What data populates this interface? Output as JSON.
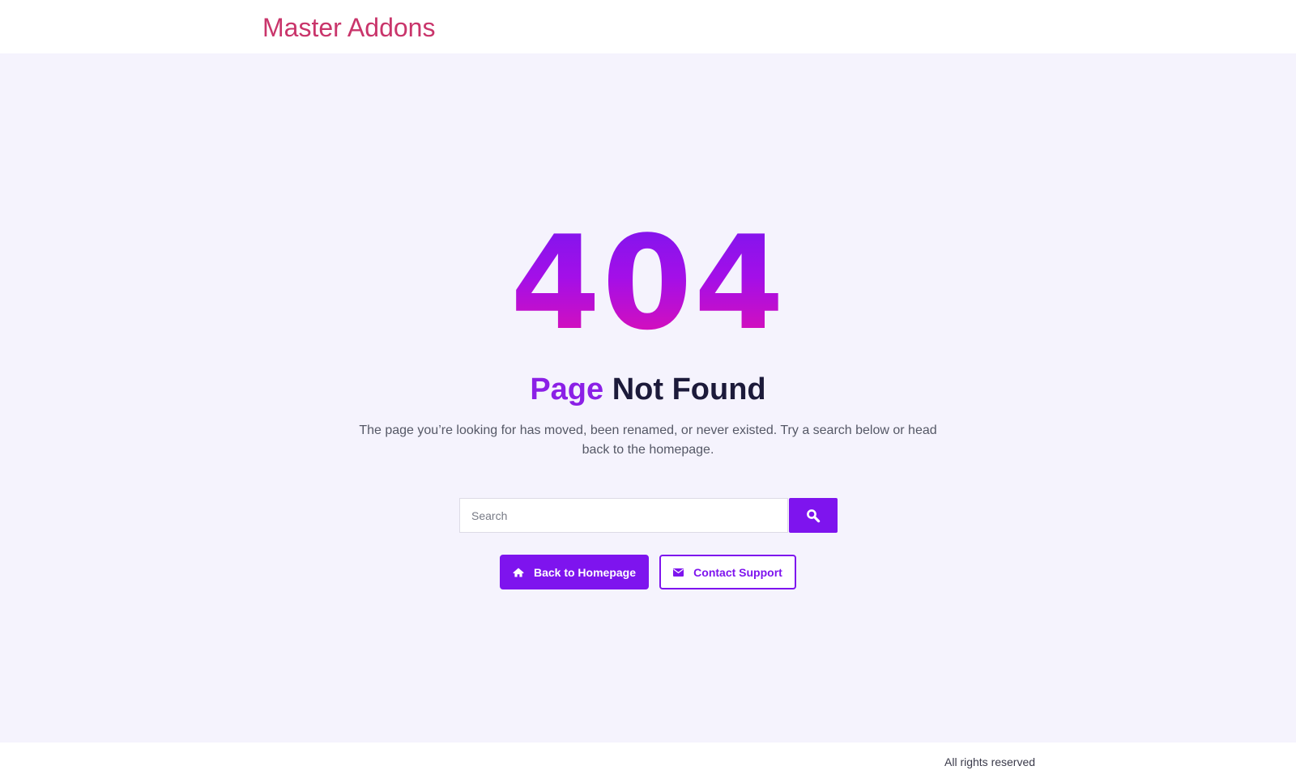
{
  "header": {
    "site_title": "Master Addons"
  },
  "error": {
    "code": "404",
    "heading_accent": "Page",
    "heading_rest": "Not Found",
    "description": "The page you’re looking for has moved, been renamed, or never existed. Try a search below or head back to the homepage."
  },
  "search": {
    "placeholder": "Search",
    "value": "",
    "button_icon": "search-icon"
  },
  "actions": {
    "home_label": "Back to Homepage",
    "home_icon": "home-icon",
    "support_label": "Contact Support",
    "support_icon": "envelope-icon"
  },
  "footer": {
    "text": "All rights reserved"
  },
  "colors": {
    "brand_title": "#c9356b",
    "accent": "#7e14ee",
    "gradient_top": "#7c16ee",
    "gradient_bottom": "#e10fb0",
    "background": "#f5f3fd",
    "heading": "#1c1a3a"
  }
}
